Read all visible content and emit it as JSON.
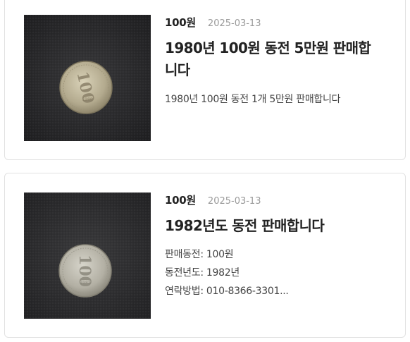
{
  "listings": [
    {
      "price": "100원",
      "date": "2025-03-13",
      "title_lines": [
        "1980년 100원 동전 5만원 판매합",
        "니다"
      ],
      "description_lines": [
        "1980년 100원 동전 1개 5만원 판매합니다"
      ],
      "image": {
        "subject": "100-won-coin-photo",
        "background": "#2b2b2d",
        "coin_color": "#b9b19a"
      }
    },
    {
      "price": "100원",
      "date": "2025-03-13",
      "title_lines": [
        "1982년도 동전 판매합니다"
      ],
      "description_lines": [
        "판매동전: 100원",
        "동전년도: 1982년",
        "연락방법: 010-8366-3301..."
      ],
      "image": {
        "subject": "100-won-coin-photo",
        "background": "#2f2f31",
        "coin_color": "#b8b6ab"
      }
    }
  ]
}
